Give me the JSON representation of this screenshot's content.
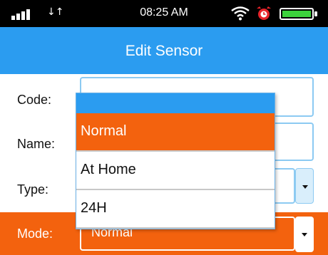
{
  "status_bar": {
    "time": "08:25 AM",
    "data_icon": "↓↑",
    "signal_icon": "signal-bars-icon",
    "wifi_icon": "wifi-icon",
    "alarm_icon": "alarm-icon",
    "battery_icon": "battery-icon"
  },
  "header": {
    "title": "Edit Sensor"
  },
  "form": {
    "code_label": "Code:",
    "name_label": "Name:",
    "type_label": "Type:",
    "mode_label": "Mode:",
    "mode_value": "Normal"
  },
  "dropdown": {
    "options": [
      {
        "label": "Normal",
        "selected": true
      },
      {
        "label": "At Home",
        "selected": false
      },
      {
        "label": "24H",
        "selected": false
      }
    ]
  },
  "colors": {
    "header_blue": "#2b9cf0",
    "accent_orange": "#f3620e",
    "field_border": "#8ccaf2"
  }
}
